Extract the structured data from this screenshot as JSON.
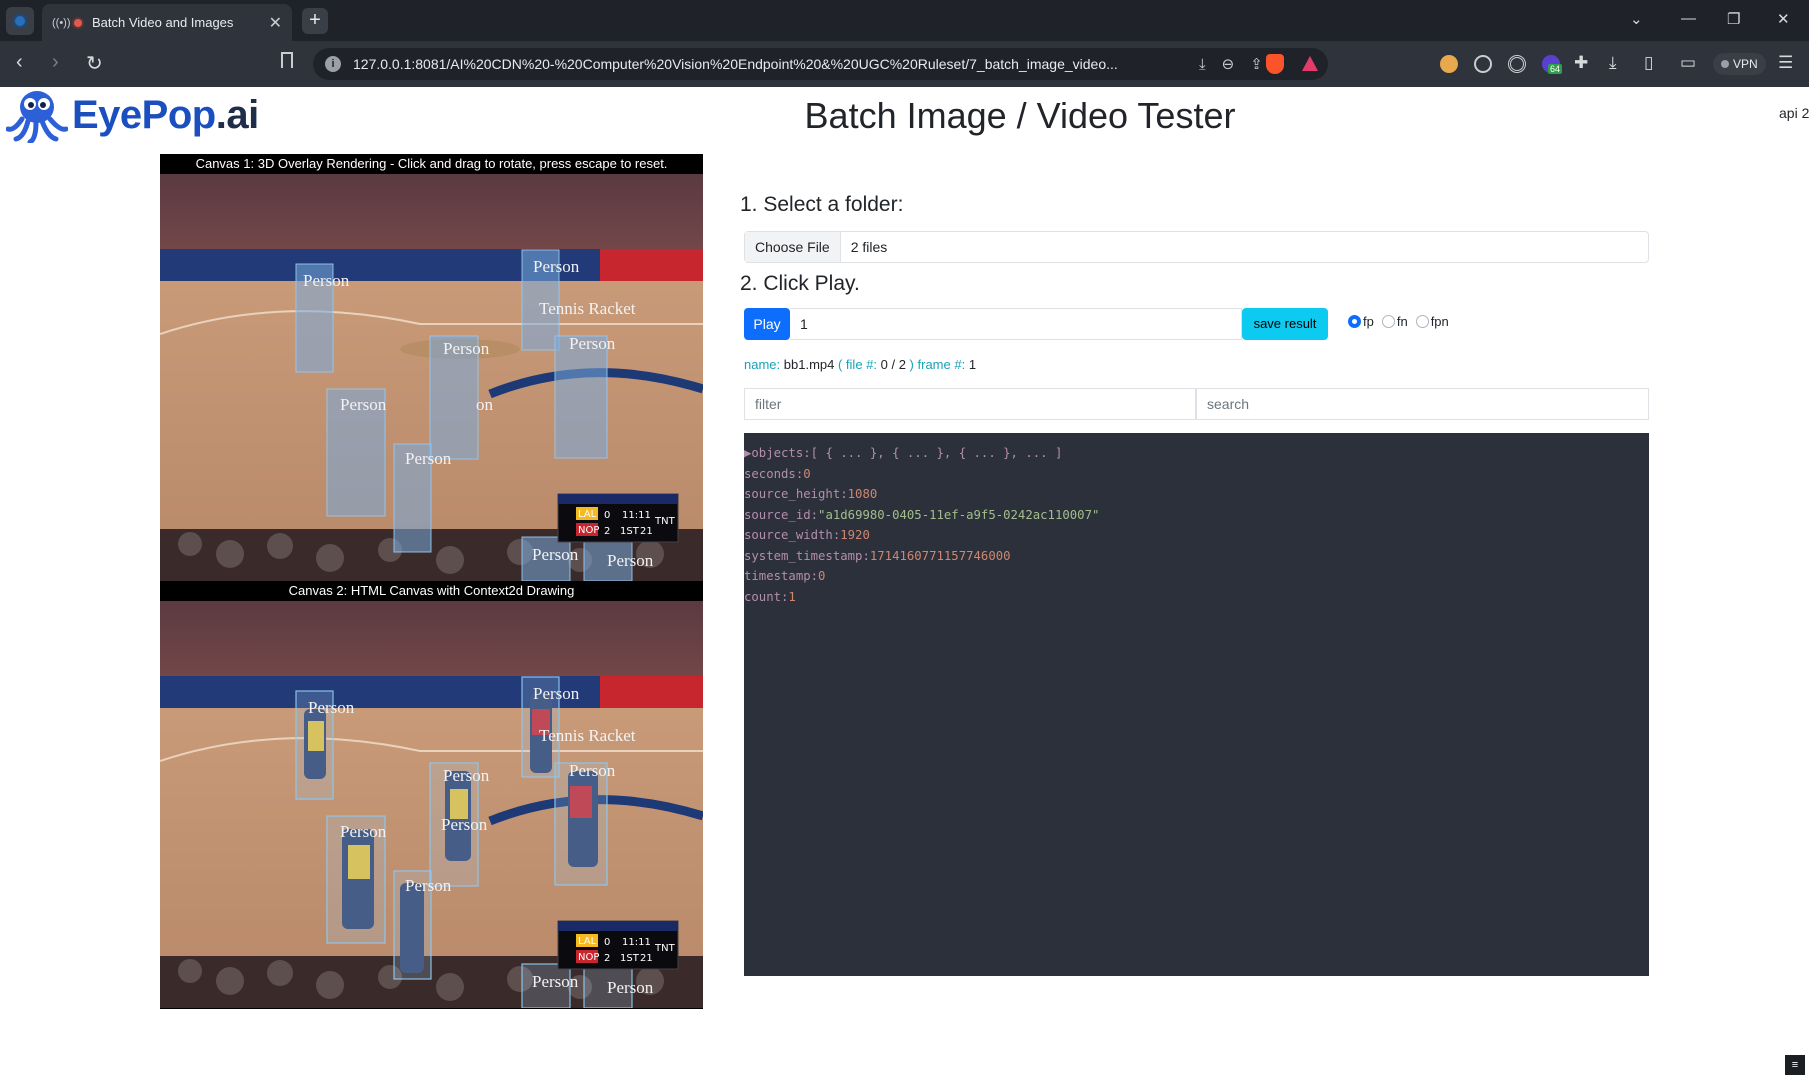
{
  "browser": {
    "tab_title": "Batch Video and Images",
    "tab_close": "✕",
    "new_tab": "+",
    "url": "127.0.0.1:8081/AI%20CDN%20-%20Computer%20Vision%20Endpoint%20&%20UGC%20Ruleset/7_batch_image_video...",
    "vpn_label": "VPN",
    "ext_badge": "64"
  },
  "logo": {
    "brand_part1": "EyePop",
    "brand_part2": ".ai"
  },
  "page": {
    "title": "Batch Image / Video Tester",
    "api_label": "api 2"
  },
  "canvas1": {
    "caption": "Canvas 1: 3D Overlay Rendering - Click and drag to rotate, press escape to reset."
  },
  "canvas2": {
    "caption": "Canvas 2: HTML Canvas with Context2d Drawing"
  },
  "detections": {
    "person": "Person",
    "racket": "Tennis Racket",
    "on": "on"
  },
  "scoreboard": {
    "team1": "LAL",
    "team2": "NOP",
    "score1": "0",
    "score2": "2",
    "clock": "11:11",
    "period": "1ST",
    "shot": "21",
    "network": "TNT"
  },
  "step1": {
    "heading": "1. Select a folder:",
    "choose_label": "Choose File",
    "file_value": "2 files"
  },
  "step2": {
    "heading": "2. Click Play.",
    "play_label": "Play",
    "frame_value": "1",
    "save_label": "save result"
  },
  "radios": [
    {
      "label": "fp",
      "checked": true
    },
    {
      "label": "fn",
      "checked": false
    },
    {
      "label": "fpn",
      "checked": false
    }
  ],
  "meta": {
    "name_key": "name:",
    "name_value": "bb1.mp4",
    "file_key": "( file #:",
    "file_value": "0 / 2",
    "file_close": ")",
    "frame_key": "frame #:",
    "frame_value": "1"
  },
  "filters": {
    "filter_placeholder": "filter",
    "search_placeholder": "search"
  },
  "json_view": {
    "objects_key": "▶objects:",
    "objects_value": "[ { ... }, { ... }, { ... }, ... ]",
    "rows": [
      {
        "key": "seconds:",
        "value": "0",
        "kind": "num"
      },
      {
        "key": "source_height:",
        "value": "1080",
        "kind": "num"
      },
      {
        "key": "source_id:",
        "value": "\"a1d69980-0405-11ef-a9f5-0242ac110007\"",
        "kind": "str"
      },
      {
        "key": "source_width:",
        "value": "1920",
        "kind": "num"
      },
      {
        "key": "system_timestamp:",
        "value": "1714160771157746000",
        "kind": "num"
      },
      {
        "key": "timestamp:",
        "value": "0",
        "kind": "num"
      },
      {
        "key": "count:",
        "value": "1",
        "kind": "num"
      }
    ]
  },
  "corner_button": "≡",
  "colors": {
    "accent": "#0d6efd",
    "info": "#0dcaf0",
    "json_bg": "#2b303b",
    "chrome_bg": "#1f2329"
  }
}
